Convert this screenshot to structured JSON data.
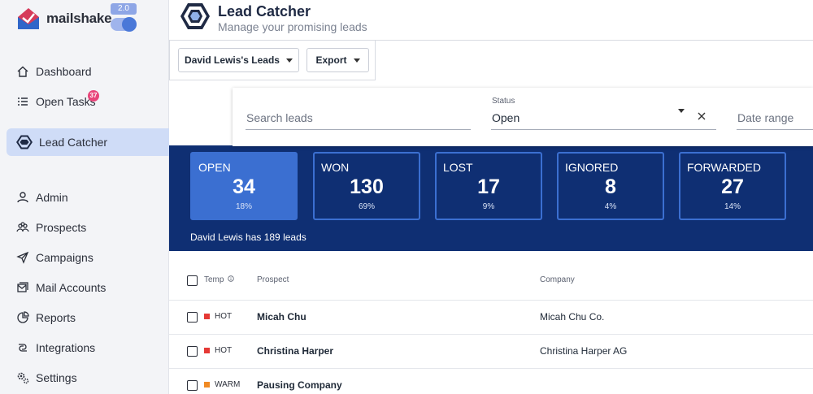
{
  "app": {
    "name": "mailshake",
    "version": "2.0"
  },
  "sidebar": {
    "items": [
      {
        "label": "Dashboard",
        "icon": "home-icon"
      },
      {
        "label": "Open Tasks",
        "icon": "tasks-icon",
        "badge": "37"
      },
      {
        "label": "Lead Catcher",
        "icon": "lead-catcher-icon",
        "active": true
      },
      {
        "label": "Admin",
        "icon": "user-icon"
      },
      {
        "label": "Prospects",
        "icon": "people-icon"
      },
      {
        "label": "Campaigns",
        "icon": "send-icon"
      },
      {
        "label": "Mail Accounts",
        "icon": "mail-accounts-icon"
      },
      {
        "label": "Reports",
        "icon": "reports-icon"
      },
      {
        "label": "Integrations",
        "icon": "integrations-icon"
      },
      {
        "label": "Settings",
        "icon": "settings-icon"
      }
    ]
  },
  "header": {
    "title": "Lead Catcher",
    "subtitle": "Manage your promising leads"
  },
  "toolbar": {
    "leads_button": "David Lewis's Leads",
    "export_button": "Export"
  },
  "filters": {
    "search_placeholder": "Search leads",
    "status_label": "Status",
    "status_value": "Open",
    "date_placeholder": "Date range"
  },
  "stats": [
    {
      "label": "OPEN",
      "count": "34",
      "pct": "18%",
      "active": true
    },
    {
      "label": "WON",
      "count": "130",
      "pct": "69%"
    },
    {
      "label": "LOST",
      "count": "17",
      "pct": "9%"
    },
    {
      "label": "IGNORED",
      "count": "8",
      "pct": "4%"
    },
    {
      "label": "FORWARDED",
      "count": "27",
      "pct": "14%"
    }
  ],
  "summary": "David Lewis has 189 leads",
  "table": {
    "columns": {
      "temp": "Temp",
      "prospect": "Prospect",
      "company": "Company"
    },
    "rows": [
      {
        "temp": "HOT",
        "temp_color": "#e53935",
        "prospect": "Micah Chu",
        "company": "Micah Chu Co."
      },
      {
        "temp": "HOT",
        "temp_color": "#e53935",
        "prospect": "Christina Harper",
        "company": "Christina Harper AG"
      },
      {
        "temp": "WARM",
        "temp_color": "#f08a24",
        "prospect": "Pausing Company",
        "company": ""
      }
    ]
  },
  "colors": {
    "brand_blue": "#0f2f73",
    "accent_blue": "#3b6fd1",
    "badge_pink": "#e8457a"
  }
}
